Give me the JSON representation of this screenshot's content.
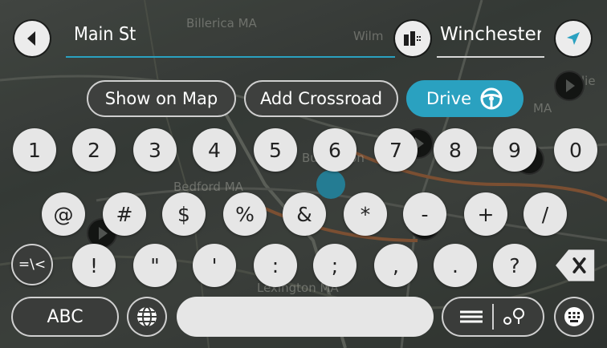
{
  "search": {
    "query": "Main St",
    "area": "Winchester,",
    "accent_color": "#2aa1c0"
  },
  "map": {
    "labels": [
      "Billerica MA",
      "Wilm",
      "Bedford MA",
      "Burlington",
      "Lexington MA",
      "lie",
      "MA"
    ]
  },
  "actions": {
    "show_on_map": "Show on Map",
    "add_crossroad": "Add Crossroad",
    "drive": "Drive"
  },
  "keyboard": {
    "row1": [
      "1",
      "2",
      "3",
      "4",
      "5",
      "6",
      "7",
      "8",
      "9",
      "0"
    ],
    "row2": [
      "@",
      "#",
      "$",
      "%",
      "&",
      "*",
      "-",
      "+",
      "/"
    ],
    "row3_toggle": "=\\<",
    "row3": [
      "!",
      "\"",
      "'",
      ":",
      ";",
      ",",
      "."
    ],
    "row3_last": "?",
    "abc": "ABC"
  },
  "icons": {
    "back": "back-arrow-icon",
    "area_selector": "building-area-icon",
    "current_location": "location-arrow-icon",
    "drive": "steering-wheel-icon",
    "backspace": "backspace-icon",
    "language": "globe-icon",
    "list_view": "list-icon",
    "map_view": "map-results-icon",
    "keyboard": "keyboard-hide-icon"
  }
}
